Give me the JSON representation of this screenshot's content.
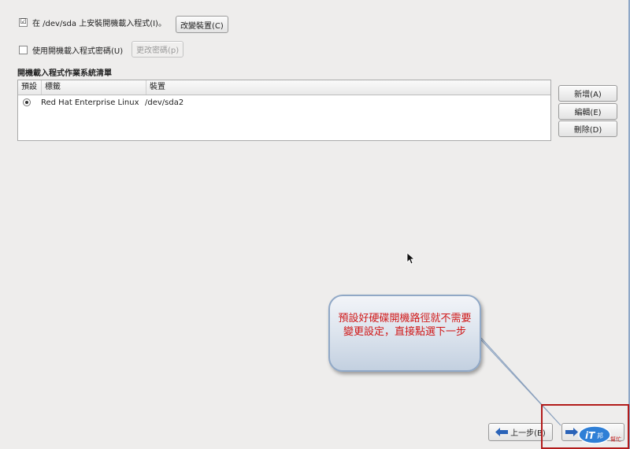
{
  "top": {
    "install_checkbox_checked": true,
    "install_checkbox_mark": "☑",
    "install_label": "在 /dev/sda 上安裝開機載入程式(I)。",
    "change_device_button": "改變裝置(C)",
    "password_checkbox_checked": false,
    "password_label": "使用開機載入程式密碼(U)",
    "change_password_button": "更改密碼(p)"
  },
  "bootlist": {
    "title": "開機載入程式作業系統清單",
    "columns": [
      "預設",
      "標籤",
      "裝置"
    ],
    "rows": [
      {
        "default": true,
        "label": "Red Hat Enterprise Linux",
        "device": "/dev/sda2"
      }
    ],
    "add_button": "新增(A)",
    "edit_button": "編輯(E)",
    "delete_button": "刪除(D)"
  },
  "callout": {
    "text": "預設好硬碟開機路徑就不需要變更設定，直接點選下一步",
    "text_color": "#d01818"
  },
  "nav": {
    "back_button": "上一步(B)",
    "next_button": "下一步(N)"
  },
  "watermark": {
    "text": "iT邦 幫忙"
  },
  "colors": {
    "background": "#eeedec",
    "highlight_box": "#b21b1b",
    "arrow_blue": "#2a63b8"
  }
}
